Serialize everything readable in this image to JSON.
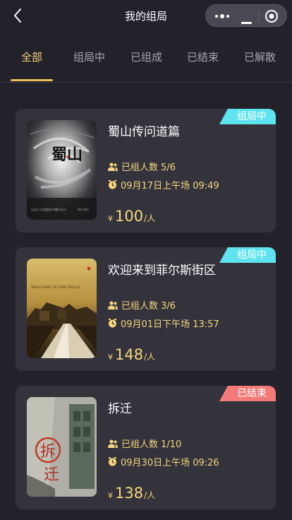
{
  "header": {
    "title": "我的组局",
    "back_icon": "chevron-left-icon",
    "capsule_icons": [
      "more-dots-icon",
      "minimize-icon",
      "target-close-icon"
    ]
  },
  "tabs": [
    {
      "label": "全部",
      "active": true
    },
    {
      "label": "组局中",
      "active": false
    },
    {
      "label": "已组成",
      "active": false
    },
    {
      "label": "已结束",
      "active": false
    },
    {
      "label": "已解散",
      "active": false
    }
  ],
  "cards": [
    {
      "title": "蜀山传问道篇",
      "status": "组局中",
      "status_color": "#5ee3ef",
      "members": "已组人数 5/6",
      "time": "09月17日上午场 09:49",
      "currency": "¥",
      "price": "100",
      "unit": "/人",
      "poster_title": "蜀山",
      "poster_footer": [
        "出品方·问道篇剧本杀",
        "剧本设计",
        "发行单位"
      ]
    },
    {
      "title": "欢迎来到菲尔斯街区",
      "status": "组局中",
      "status_color": "#5ee3ef",
      "members": "已组人数 3/6",
      "time": "09月01日下午场 13:57",
      "currency": "¥",
      "price": "148",
      "unit": "/人",
      "poster_title": "WELCOME TO THE FELLS"
    },
    {
      "title": "拆迁",
      "status": "已结束",
      "status_color": "#f47a7a",
      "members": "已组人数 1/10",
      "time": "09月30日上午场 09:26",
      "currency": "¥",
      "price": "138",
      "unit": "/人",
      "poster_title": "拆",
      "poster_subtitle": "迁"
    }
  ],
  "colors": {
    "background": "#23222b",
    "card": "#34333c",
    "accent": "#f5d67e",
    "tab_inactive": "#a6a4b0"
  }
}
